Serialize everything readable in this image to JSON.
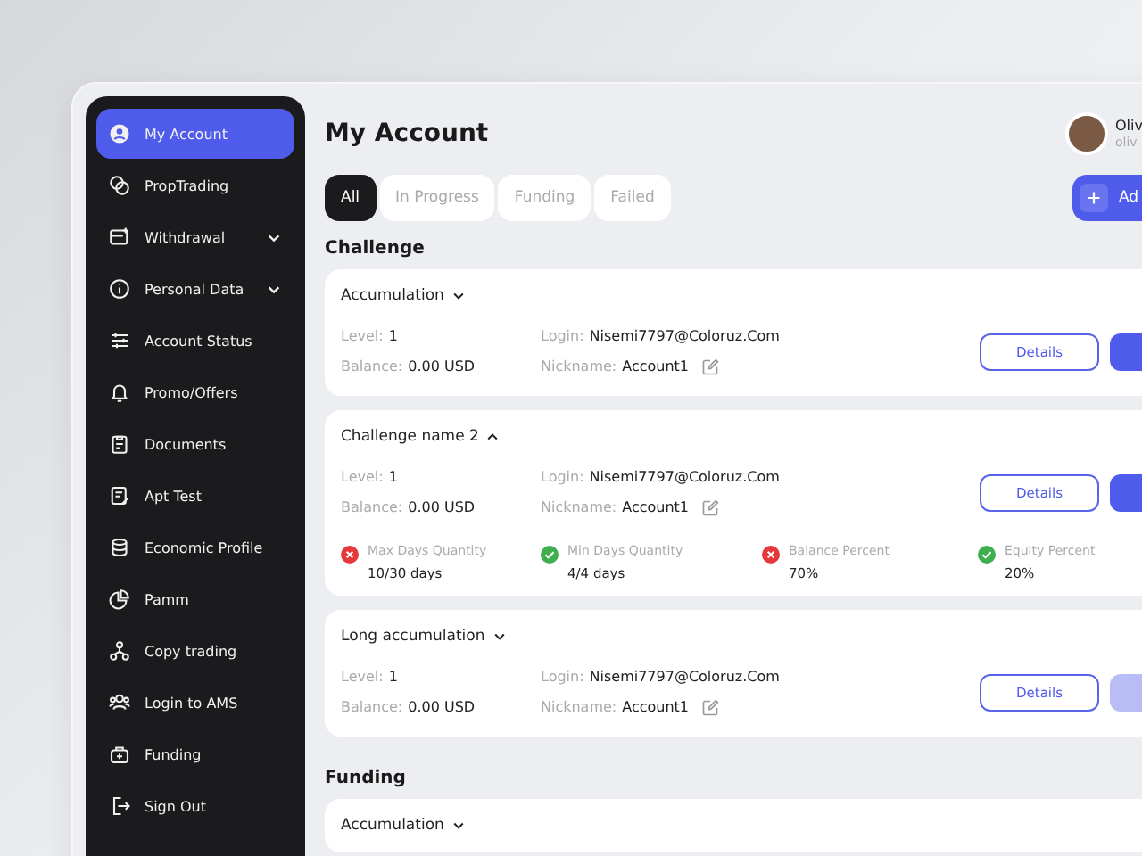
{
  "sidebar": {
    "items": [
      {
        "label": "My Account",
        "selected": true,
        "expandable": false
      },
      {
        "label": "PropTrading",
        "selected": false,
        "expandable": false
      },
      {
        "label": "Withdrawal",
        "selected": false,
        "expandable": true
      },
      {
        "label": "Personal Data",
        "selected": false,
        "expandable": true
      },
      {
        "label": "Account Status",
        "selected": false,
        "expandable": false
      },
      {
        "label": "Promo/Offers",
        "selected": false,
        "expandable": false
      },
      {
        "label": "Documents",
        "selected": false,
        "expandable": false
      },
      {
        "label": "Apt Test",
        "selected": false,
        "expandable": false
      },
      {
        "label": "Economic Profile",
        "selected": false,
        "expandable": false
      },
      {
        "label": "Pamm",
        "selected": false,
        "expandable": false
      },
      {
        "label": "Copy trading",
        "selected": false,
        "expandable": false
      },
      {
        "label": "Login to AMS",
        "selected": false,
        "expandable": false
      },
      {
        "label": "Funding",
        "selected": false,
        "expandable": false
      },
      {
        "label": "Sign Out",
        "selected": false,
        "expandable": false
      }
    ]
  },
  "page_title": "My Account",
  "user": {
    "name": "Oliv",
    "email": "oliv"
  },
  "tabs": [
    {
      "label": "All",
      "selected": true
    },
    {
      "label": "In Progress",
      "selected": false
    },
    {
      "label": "Funding",
      "selected": false
    },
    {
      "label": "Failed",
      "selected": false
    }
  ],
  "add_button": {
    "label": "Ad"
  },
  "sections": [
    {
      "title": "Challenge",
      "accounts": [
        {
          "name": "Accumulation",
          "expanded": false,
          "action_disabled": false,
          "details_label": "Details",
          "fields": [
            {
              "label": "Level:",
              "value": "1"
            },
            {
              "label": "Balance:",
              "value": "0.00 USD"
            },
            {
              "label": "Login:",
              "value": "Nisemi7797@Coloruz.Com"
            },
            {
              "label": "Nickname:",
              "value": "Account1"
            }
          ]
        },
        {
          "name": "Challenge name 2",
          "expanded": true,
          "action_disabled": false,
          "details_label": "Details",
          "fields": [
            {
              "label": "Level:",
              "value": "1"
            },
            {
              "label": "Balance:",
              "value": "0.00 USD"
            },
            {
              "label": "Login:",
              "value": "Nisemi7797@Coloruz.Com"
            },
            {
              "label": "Nickname:",
              "value": "Account1"
            }
          ],
          "criteria": [
            {
              "label": "Max Days Quantity",
              "value": "10/30 days",
              "passed": false
            },
            {
              "label": "Min Days Quantity",
              "value": "4/4 days",
              "passed": true
            },
            {
              "label": "Balance Percent",
              "value": "70%",
              "passed": false
            },
            {
              "label": "Equity Percent",
              "value": "20%",
              "passed": true
            }
          ]
        },
        {
          "name": "Long accumulation",
          "expanded": false,
          "action_disabled": true,
          "details_label": "Details",
          "fields": [
            {
              "label": "Level:",
              "value": "1"
            },
            {
              "label": "Balance:",
              "value": "0.00 USD"
            },
            {
              "label": "Login:",
              "value": "Nisemi7797@Coloruz.Com"
            },
            {
              "label": "Nickname:",
              "value": "Account1"
            }
          ]
        }
      ]
    },
    {
      "title": "Funding",
      "accounts": [
        {
          "name": "Accumulation",
          "expanded": false
        }
      ]
    }
  ]
}
